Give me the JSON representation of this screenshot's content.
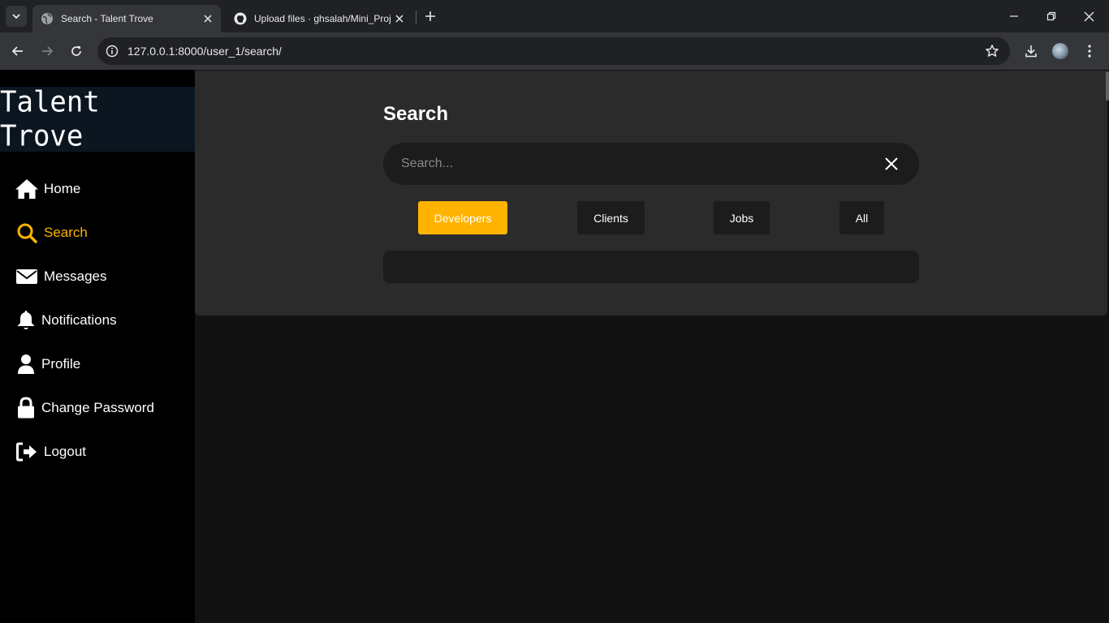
{
  "browser": {
    "tabs": [
      {
        "title": "Search - Talent Trove",
        "icon": "globe-icon",
        "active": true
      },
      {
        "title": "Upload files · ghsalah/Mini_Proj",
        "icon": "github-icon",
        "active": false
      }
    ],
    "url": "127.0.0.1:8000/user_1/search/"
  },
  "sidebar": {
    "brand": "Talent Trove",
    "items": [
      {
        "label": "Home",
        "icon": "home-icon"
      },
      {
        "label": "Search",
        "icon": "search-icon",
        "active": true
      },
      {
        "label": "Messages",
        "icon": "envelope-icon"
      },
      {
        "label": "Notifications",
        "icon": "bell-icon"
      },
      {
        "label": "Profile",
        "icon": "user-icon"
      },
      {
        "label": "Change Password",
        "icon": "lock-icon"
      },
      {
        "label": "Logout",
        "icon": "logout-icon"
      }
    ]
  },
  "search": {
    "title": "Search",
    "placeholder": "Search...",
    "value": "",
    "filters": [
      {
        "label": "Developers",
        "active": true
      },
      {
        "label": "Clients"
      },
      {
        "label": "Jobs"
      },
      {
        "label": "All"
      }
    ]
  },
  "colors": {
    "accent": "#ffb300",
    "sidebar_bg": "#000000",
    "brand_bg": "#0b1621",
    "panel_bg": "#2b2b2b",
    "input_bg": "#1c1c1c",
    "page_bg": "#121212"
  }
}
